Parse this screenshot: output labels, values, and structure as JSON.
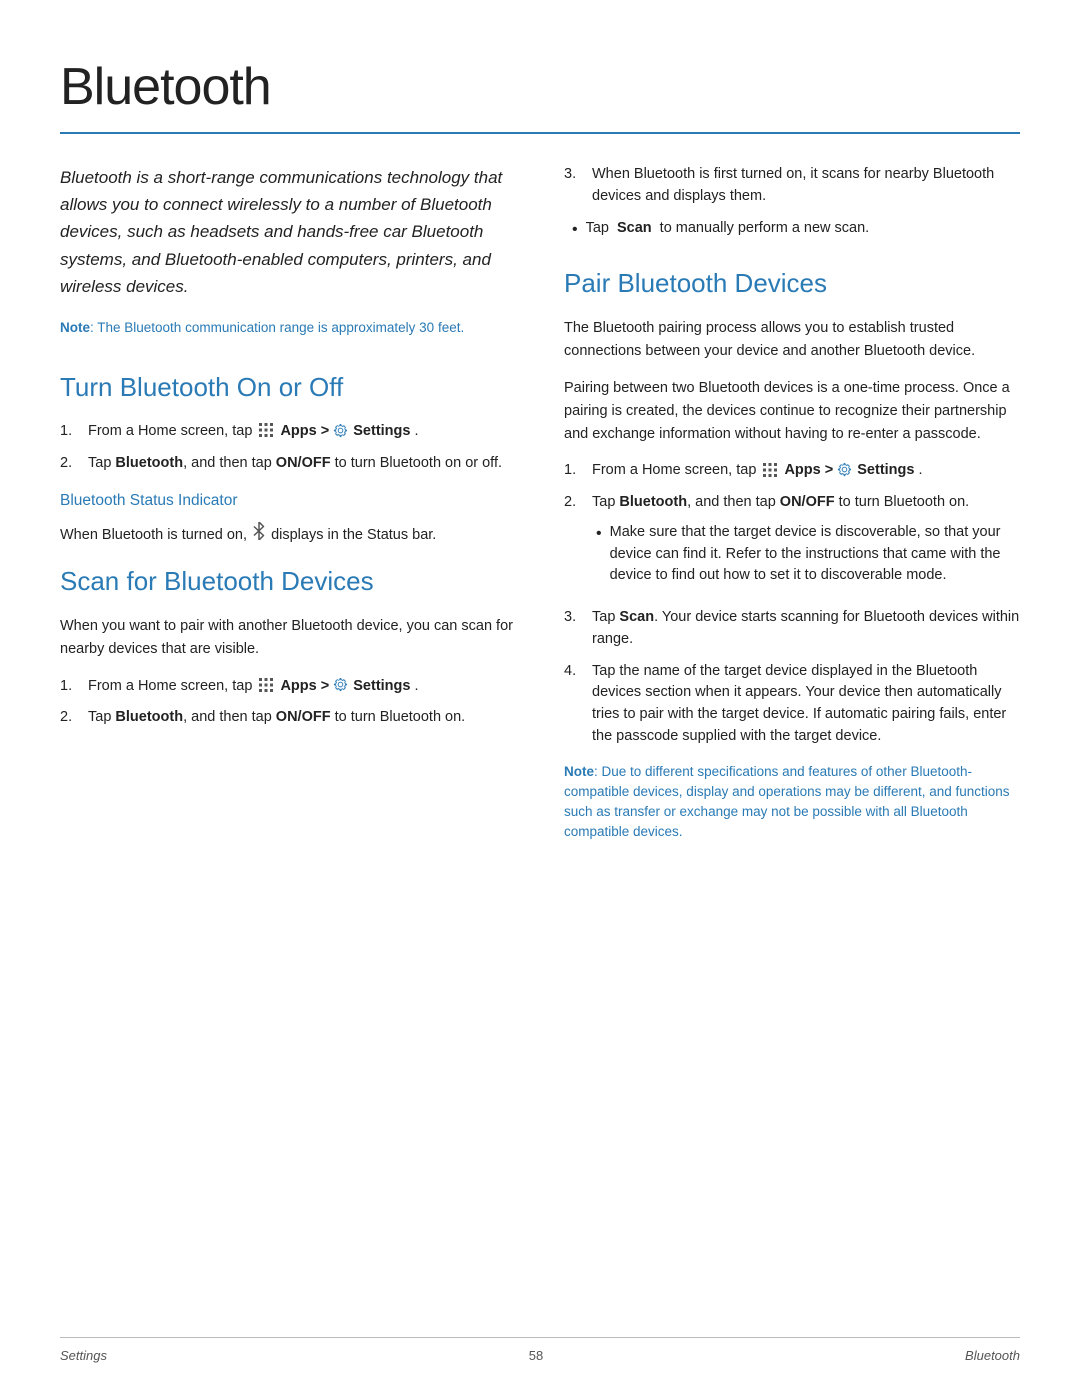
{
  "page": {
    "title": "Bluetooth",
    "title_rule_color": "#2a7ab5"
  },
  "footer": {
    "left": "Settings",
    "center": "58",
    "right": "Bluetooth"
  },
  "intro": {
    "text": "Bluetooth is a short-range communications technology that allows you to connect wirelessly to a number of Bluetooth devices, such as headsets and hands-free car Bluetooth systems, and Bluetooth-enabled computers, printers, and wireless devices.",
    "note_label": "Note",
    "note_text": ": The Bluetooth communication range is approximately 30 feet."
  },
  "turn_section": {
    "title": "Turn Bluetooth On or Off",
    "steps": [
      {
        "num": "1.",
        "text_before": "From a Home screen, tap",
        "apps_label": "Apps >",
        "settings_label": "Settings",
        "settings_dot": " ."
      },
      {
        "num": "2.",
        "text": "Tap Bluetooth, and then tap ON/OFF to turn Bluetooth on or off."
      }
    ],
    "subsection_title": "Bluetooth Status Indicator",
    "subsection_body": "When Bluetooth is turned on,",
    "subsection_body2": "displays in the Status bar."
  },
  "scan_section": {
    "title": "Scan for Bluetooth Devices",
    "intro": "When you want to pair with another Bluetooth device, you can scan for nearby devices that are visible.",
    "steps": [
      {
        "num": "1.",
        "text_before": "From a Home screen, tap",
        "apps_label": "Apps >",
        "settings_label": "Settings",
        "settings_dot": " ."
      },
      {
        "num": "2.",
        "text": "Tap Bluetooth, and then tap ON/OFF to turn Bluetooth on."
      }
    ],
    "step3": "When Bluetooth is first turned on, it scans for nearby Bluetooth devices and displays them.",
    "bullet1_bold": "Scan",
    "bullet1_rest": "to manually perform a new scan."
  },
  "pair_section": {
    "title": "Pair Bluetooth Devices",
    "intro1": "The Bluetooth pairing process allows you to establish trusted connections between your device and another Bluetooth device.",
    "intro2": "Pairing between two Bluetooth devices is a one-time process. Once a pairing is created, the devices continue to recognize their partnership and exchange information without having to re-enter a passcode.",
    "steps": [
      {
        "num": "1.",
        "text_before": "From a Home screen, tap",
        "apps_label": "Apps >",
        "settings_label": "Settings",
        "settings_dot": " ."
      },
      {
        "num": "2.",
        "text": "Tap Bluetooth, and then tap ON/OFF to turn Bluetooth on.",
        "bullet": "Make sure that the target device is discoverable, so that your device can find it. Refer to the instructions that came with the device to find out how to set it to discoverable mode."
      },
      {
        "num": "3.",
        "text_bold": "Scan",
        "text_rest": ". Your device starts scanning for Bluetooth devices within range."
      },
      {
        "num": "4.",
        "text": "Tap the name of the target device displayed in the Bluetooth devices section when it appears. Your device then automatically tries to pair with the target device. If automatic pairing fails, enter the passcode supplied with the target device."
      }
    ],
    "note_label": "Note",
    "note_text": ": Due to different specifications and features of other Bluetooth-compatible devices, display and operations may be different, and functions such as transfer or exchange may not be possible with all Bluetooth compatible devices."
  }
}
